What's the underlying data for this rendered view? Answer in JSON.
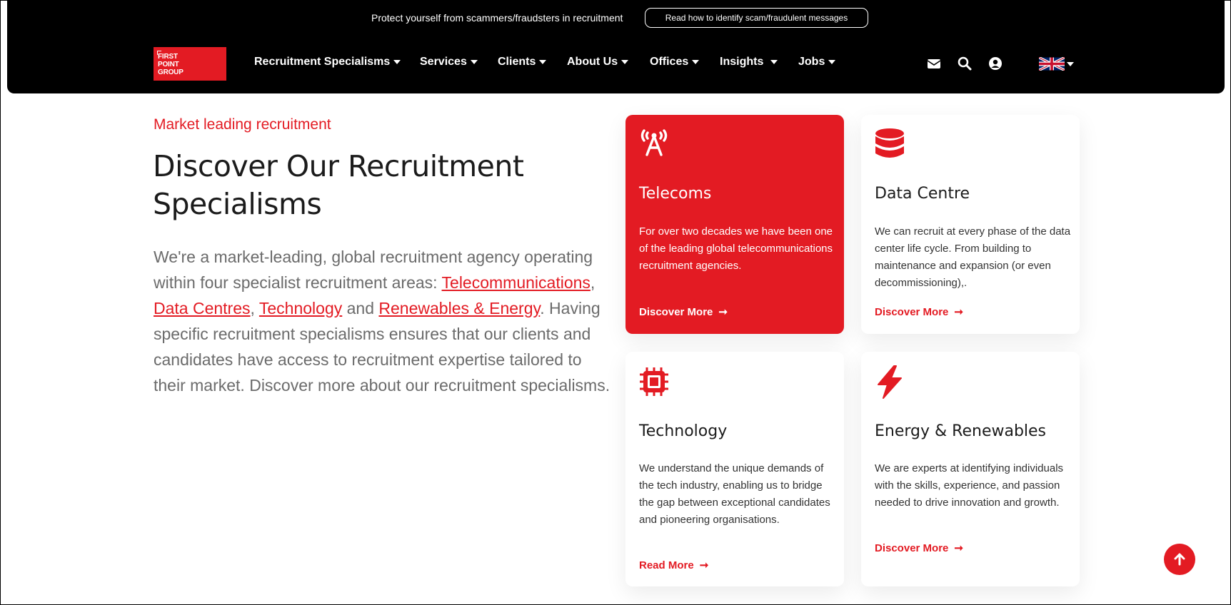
{
  "notice": {
    "text": "Protect yourself from scammers/fraudsters in recruitment",
    "button_label": "Read how to identify scam/fraudulent messages"
  },
  "logo": {
    "lines": [
      "FIRST",
      "POINT",
      "GROUP"
    ]
  },
  "nav": {
    "items": [
      {
        "label": "Recruitment Specialisms"
      },
      {
        "label": "Services"
      },
      {
        "label": "Clients"
      },
      {
        "label": "About Us"
      },
      {
        "label": "Offices"
      },
      {
        "label": "Insights"
      },
      {
        "label": "Jobs"
      }
    ],
    "icons": [
      "envelope-icon",
      "search-icon",
      "user-icon",
      "uk-flag-icon"
    ]
  },
  "main": {
    "eyebrow": "Market leading recruitment",
    "headline": "Discover Our Recruitment Specialisms",
    "intro": {
      "part1": "We're a market-leading, global recruitment agency operating within four specialist recruitment areas: ",
      "link1": "Telecommunications",
      "sep1": ", ",
      "link2": "Data Centres",
      "sep2": ", ",
      "link3": "Technology",
      "sep3": " and ",
      "link4": "Renewables & Energy",
      "part2": ". Having specific recruitment specialisms ensures that our clients and candidates have access to recruitment expertise tailored to their market. Discover more about our recruitment specialisms."
    }
  },
  "cards": [
    {
      "title": "Telecoms",
      "description": "For over two decades we have been one of the leading global telecommunications recruitment agencies.",
      "link": "Discover More",
      "icon": "antenna-tower-icon"
    },
    {
      "title": "Data Centre",
      "description": "We can recruit at every phase of the data center life cycle. From building to maintenance and expansion (or even decommissioning),.",
      "link": "Discover More",
      "icon": "database-icon"
    },
    {
      "title": "Technology",
      "description": "We understand the unique demands of the tech industry, enabling us to bridge the gap between exceptional candidates and pioneering organisations.",
      "link": "Read More",
      "icon": "microchip-icon"
    },
    {
      "title": "Energy & Renewables",
      "description": "We are experts at identifying individuals with the skills, experience, and passion needed to drive innovation and growth.",
      "link": "Discover More",
      "icon": "lightning-bolt-icon"
    }
  ],
  "colors": {
    "brand_red": "#e31b23",
    "header_bg": "#000000"
  },
  "arrow_glyph": "➞"
}
